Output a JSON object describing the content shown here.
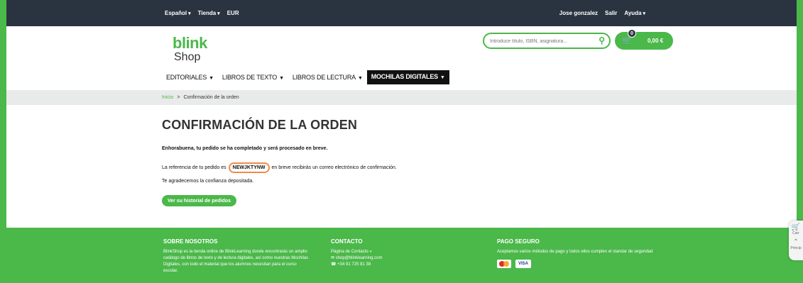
{
  "topbar": {
    "language": "Español",
    "store": "Tienda",
    "currency": "EUR",
    "user": "Jose gonzalez",
    "logout": "Salir",
    "help": "Ayuda"
  },
  "logo": {
    "brand": "blink",
    "sub": "Shop"
  },
  "search": {
    "placeholder": "Introduce título, ISBN, asignatura..."
  },
  "cart": {
    "count": "0",
    "amount": "0,00 €"
  },
  "nav": {
    "items": [
      {
        "label": "EDITORIALES"
      },
      {
        "label": "LIBROS DE TEXTO"
      },
      {
        "label": "LIBROS DE LECTURA"
      },
      {
        "label": "MOCHILAS DIGITALES"
      }
    ]
  },
  "breadcrumb": {
    "home": "Inicio",
    "sep": ">",
    "current": "Confirmación de la orden"
  },
  "main": {
    "title": "CONFIRMACIÓN DE LA ORDEN",
    "msg1": "Enhorabuena, tu pedido se ha completado y será procesado en breve.",
    "msg2_pre": "La referencia de tu pedido es",
    "reference": "NEWJKTYNW",
    "msg2_post": "en breve recibirás un correo electrónico de confirmación.",
    "msg3": "Te agradecemos la confianza depositada.",
    "history_button": "Ver su historial de pedidos"
  },
  "footer": {
    "about_title": "SOBRE NOSOTROS",
    "about_text": "BlinkShop es la tienda online de BlinkLearning donde encontrarás un amplio catálogo de libros de texto y de lectura digitales, así como nuestras Mochilas Digitales, con todo el material que los alumnos necesitan para el curso escolar.",
    "contact_title": "CONTACTO",
    "contact_page": "Página de Contacto »",
    "contact_email": "shop@blinklearning.com",
    "contact_phone": "+34 91 725 81 38",
    "pay_title": "PAGO SEGURO",
    "pay_text": "Aceptamos varios métodos de pago y todos ellos cumplen el standar de seguridad",
    "visa": "VISA"
  },
  "side": {
    "top": "Carr",
    "bottom": "Princip"
  }
}
